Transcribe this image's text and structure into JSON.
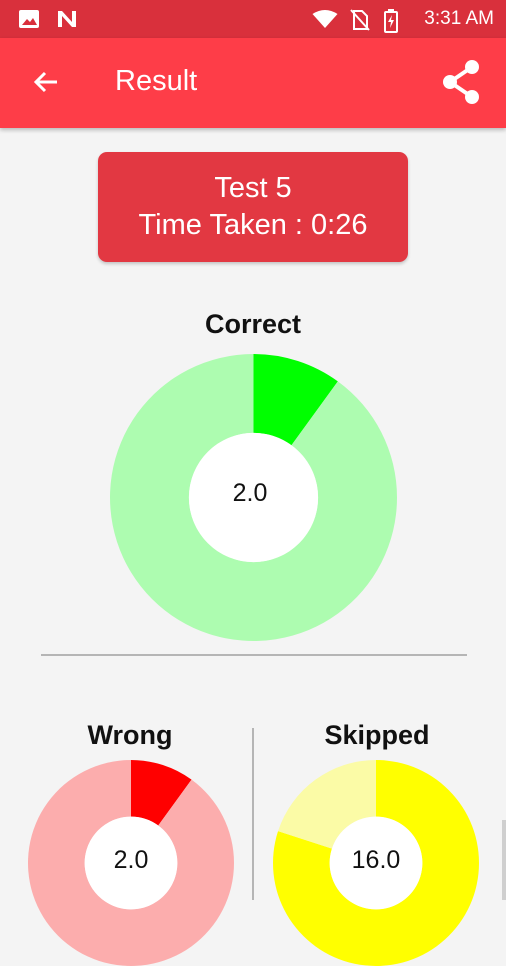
{
  "status_bar": {
    "time": "3:31 AM",
    "icons": [
      "image-icon",
      "n-notification-icon",
      "wifi-icon",
      "no-sim-icon",
      "battery-charging-icon"
    ]
  },
  "app_bar": {
    "title": "Result",
    "back_icon": "arrow-back-icon",
    "share_icon": "share-icon",
    "color": "#fe3d48"
  },
  "summary": {
    "test_name": "Test 5",
    "time_taken": "Time Taken : 0:26"
  },
  "chart_data": [
    {
      "type": "pie",
      "title": "Correct",
      "center_label": "2.0",
      "values": [
        2,
        18
      ],
      "colors": [
        "#00ff00",
        "#adfcb0"
      ]
    },
    {
      "type": "pie",
      "title": "Wrong",
      "center_label": "2.0",
      "values": [
        2,
        18
      ],
      "colors": [
        "#ff0000",
        "#fcadad"
      ]
    },
    {
      "type": "pie",
      "title": "Skipped",
      "center_label": "16.0",
      "values": [
        16,
        4
      ],
      "colors": [
        "#ffff00",
        "#fbfba6"
      ]
    }
  ]
}
